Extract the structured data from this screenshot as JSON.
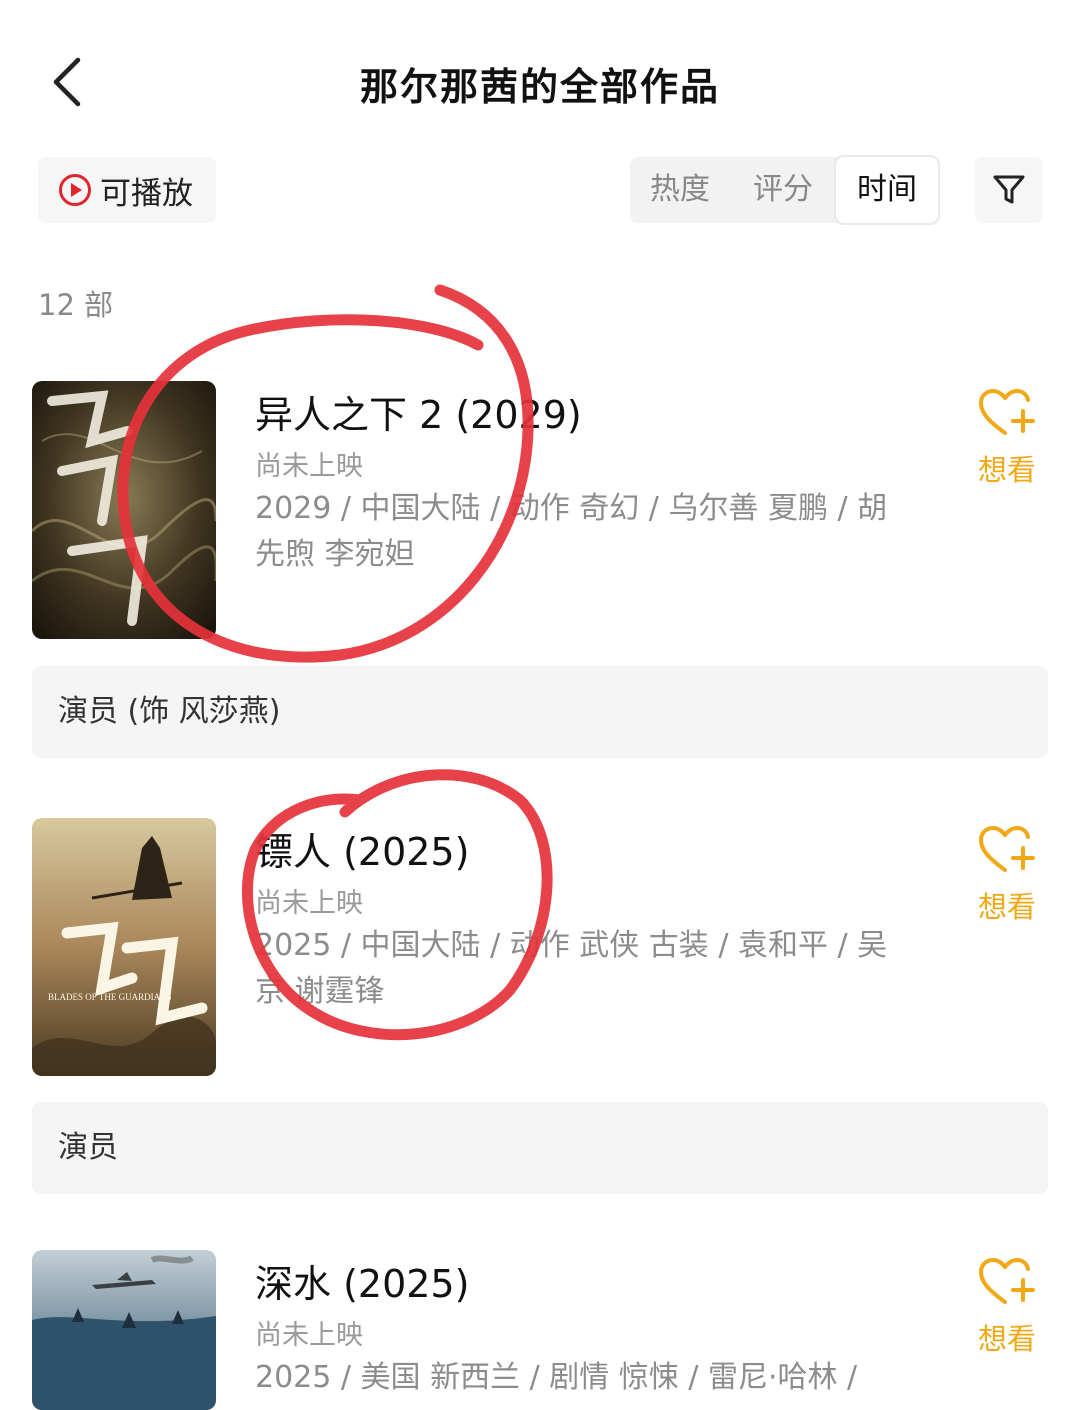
{
  "header": {
    "title": "那尔那茜的全部作品"
  },
  "toolbar": {
    "playable_label": "可播放",
    "sort_options": [
      "热度",
      "评分",
      "时间"
    ],
    "active_sort": "时间"
  },
  "count_label": "12 部",
  "movies": [
    {
      "title": "异人之下 2 (2029)",
      "status": "尚未上映",
      "meta": "2029 / 中国大陆 / 动作 奇幻 / 乌尔善 夏鹏 / 胡先煦 李宛妲",
      "want_label": "想看",
      "role": "演员 (饰 风莎燕)"
    },
    {
      "title": "镖人 (2025)",
      "status": "尚未上映",
      "meta": "2025 / 中国大陆 / 动作 武侠 古装 / 袁和平 / 吴京 谢霆锋",
      "want_label": "想看",
      "role": "演员",
      "poster_text": "BLADES OF THE GUARDIANS"
    },
    {
      "title": "深水 (2025)",
      "status": "尚未上映",
      "meta": "2025 / 美国 新西兰 / 剧情 惊悚 / 雷尼·哈林 /",
      "want_label": "想看"
    }
  ],
  "colors": {
    "accent_red": "#e0262b",
    "want_yellow": "#f2a814",
    "annotation_red": "#e5323a"
  }
}
